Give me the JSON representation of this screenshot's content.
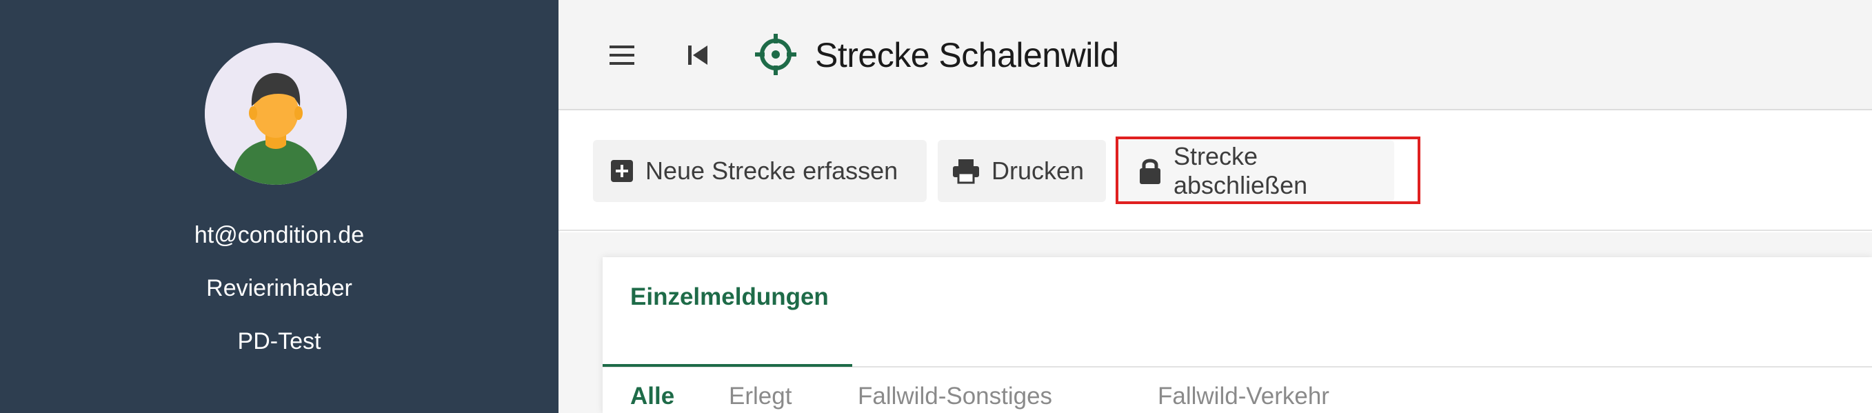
{
  "sidebar": {
    "user_email": "ht@condition.de",
    "user_role": "Revierinhaber",
    "user_org": "PD-Test"
  },
  "header": {
    "title": "Strecke Schalenwild",
    "icons": {
      "menu": "hamburger-menu-icon",
      "back": "skip-back-icon",
      "page": "crosshair-target-icon"
    }
  },
  "toolbar": {
    "new_label": "Neue Strecke erfassen",
    "print_label": "Drucken",
    "close_label": "Strecke abschließen",
    "icons": {
      "new": "plus-square-icon",
      "print": "printer-icon",
      "close": "lock-icon"
    }
  },
  "tabs": {
    "main_label": "Einzelmeldungen",
    "filters": [
      "Alle",
      "Erlegt",
      "Fallwild-Sonstiges",
      "Fallwild-Verkehr"
    ],
    "active_filter": "Alle"
  },
  "colors": {
    "sidebar_bg": "#2e3e50",
    "accent_green": "#1e6b48",
    "highlight_red": "#e02020"
  }
}
